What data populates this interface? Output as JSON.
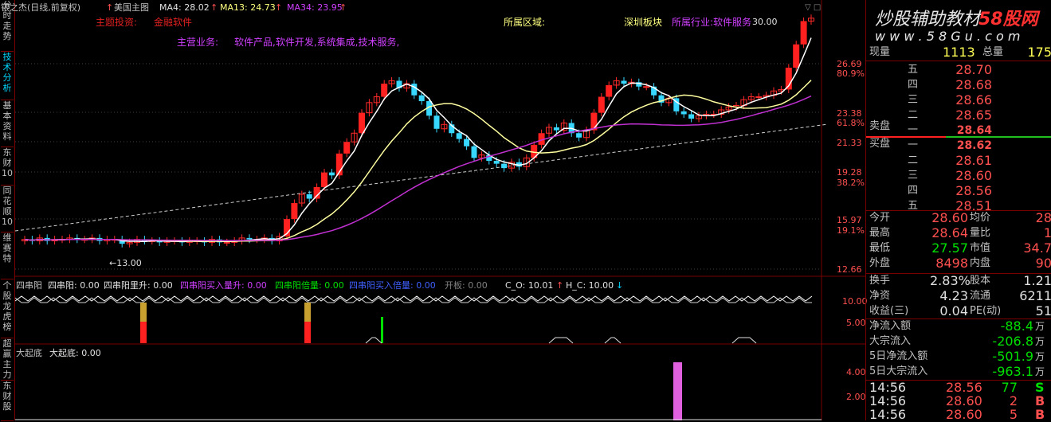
{
  "header": {
    "title": "银之杰(日线,前复权)",
    "main_indicator": "美国主图",
    "ma4": "MA4: 28.02",
    "ma13": "MA13: 24.73",
    "ma34": "MA34: 23.95",
    "concept_label": "主题投资:",
    "concept_value": "金融软件",
    "region_label": "所属区域:",
    "region_value": "深圳板块",
    "industry": "所属行业:软件服务",
    "business_label": "主营业务:",
    "business_value": "软件产品,软件开发,系统集成,技术服务,",
    "watermark_cn": "炒股辅助教材",
    "watermark_brand": "58股网",
    "watermark_url": "w w w . 5 8 G u . c o m"
  },
  "side_tabs": [
    {
      "label": "分时走势",
      "selected": false
    },
    {
      "label": "技术分析",
      "selected": true
    },
    {
      "label": "基本资料",
      "selected": false
    },
    {
      "label": "东财10",
      "selected": false
    },
    {
      "label": "同花顺10",
      "selected": false
    },
    {
      "label": "维赛特",
      "selected": false
    },
    {
      "label": "个股龙虎榜",
      "selected": false
    },
    {
      "label": "超赢主力",
      "selected": false
    },
    {
      "label": "东财股",
      "selected": false
    }
  ],
  "price_axis": [
    "30.00",
    "26.69",
    "80.9%",
    "23.38",
    "61.8%",
    "21.33",
    "19.28",
    "38.2%",
    "15.97",
    "19.1%",
    "12.66"
  ],
  "price_annotations": {
    "low_marker": "13.00"
  },
  "sub1": {
    "name": "四串阳",
    "v1": "四串阳: 0.00",
    "v2": "四串阳里升: 0.00",
    "v3": "四串阳买入量升: 0.00",
    "v4": "四串阳倍量: 0.00",
    "v5": "四串阳买入倍量: 0.00",
    "v6": "开板: 0.00",
    "v7": "C_O: 10.01",
    "v8": "H_C: 10.00",
    "axis": [
      "10.00",
      "5.00"
    ]
  },
  "sub2": {
    "name": "大起底",
    "v1": "大起底: 0.00",
    "axis": [
      "4.00",
      "2.00"
    ]
  },
  "quote": {
    "volume_label": "现量",
    "volume_value": "1113",
    "total_label": "总量",
    "total_value": "175",
    "asks": [
      {
        "level": "五",
        "price": "28.70"
      },
      {
        "level": "四",
        "price": "28.68"
      },
      {
        "level": "三",
        "price": "28.66"
      },
      {
        "level": "二",
        "price": "28.65"
      },
      {
        "level": "一",
        "price": "28.64"
      }
    ],
    "ask_side_label": "卖盘",
    "bid_side_label": "买盘",
    "bids": [
      {
        "level": "一",
        "price": "28.62"
      },
      {
        "level": "二",
        "price": "28.61"
      },
      {
        "level": "三",
        "price": "28.60"
      },
      {
        "level": "四",
        "price": "28.56"
      },
      {
        "level": "五",
        "price": "28.51"
      }
    ],
    "stats": [
      {
        "l1": "今开",
        "v1": "28.60",
        "l2": "均价",
        "v2": "28"
      },
      {
        "l1": "最高",
        "v1": "28.64",
        "l2": "量比",
        "v2": "1"
      },
      {
        "l1": "最低",
        "v1": "27.57",
        "l2": "市值",
        "v2": "34.7"
      },
      {
        "l1": "外盘",
        "v1": "8498",
        "l2": "内盘",
        "v2": "90"
      }
    ],
    "stats2": [
      {
        "l1": "换手",
        "v1": "2.83%",
        "l2": "股本",
        "v2": "1.21"
      },
      {
        "l1": "净资",
        "v1": "4.23",
        "l2": "流通",
        "v2": "6211"
      },
      {
        "l1": "收益(三)",
        "v1": "0.04",
        "l2": "PE(动)",
        "v2": "51"
      }
    ],
    "flows": [
      {
        "label": "净流入额",
        "value": "-88.4",
        "unit": "万"
      },
      {
        "label": "大宗流入",
        "value": "-206.8",
        "unit": "万"
      },
      {
        "label": "5日净流入额",
        "value": "-501.9",
        "unit": "万"
      },
      {
        "label": "5日大宗流入",
        "value": "-963.1",
        "unit": "万"
      }
    ],
    "ticks": [
      {
        "time": "14:56",
        "price": "28.56",
        "vol": "77",
        "side": "S"
      },
      {
        "time": "14:56",
        "price": "28.60",
        "vol": "2",
        "side": "B"
      },
      {
        "time": "14:56",
        "price": "28.60",
        "vol": "5",
        "side": "B"
      }
    ]
  }
}
